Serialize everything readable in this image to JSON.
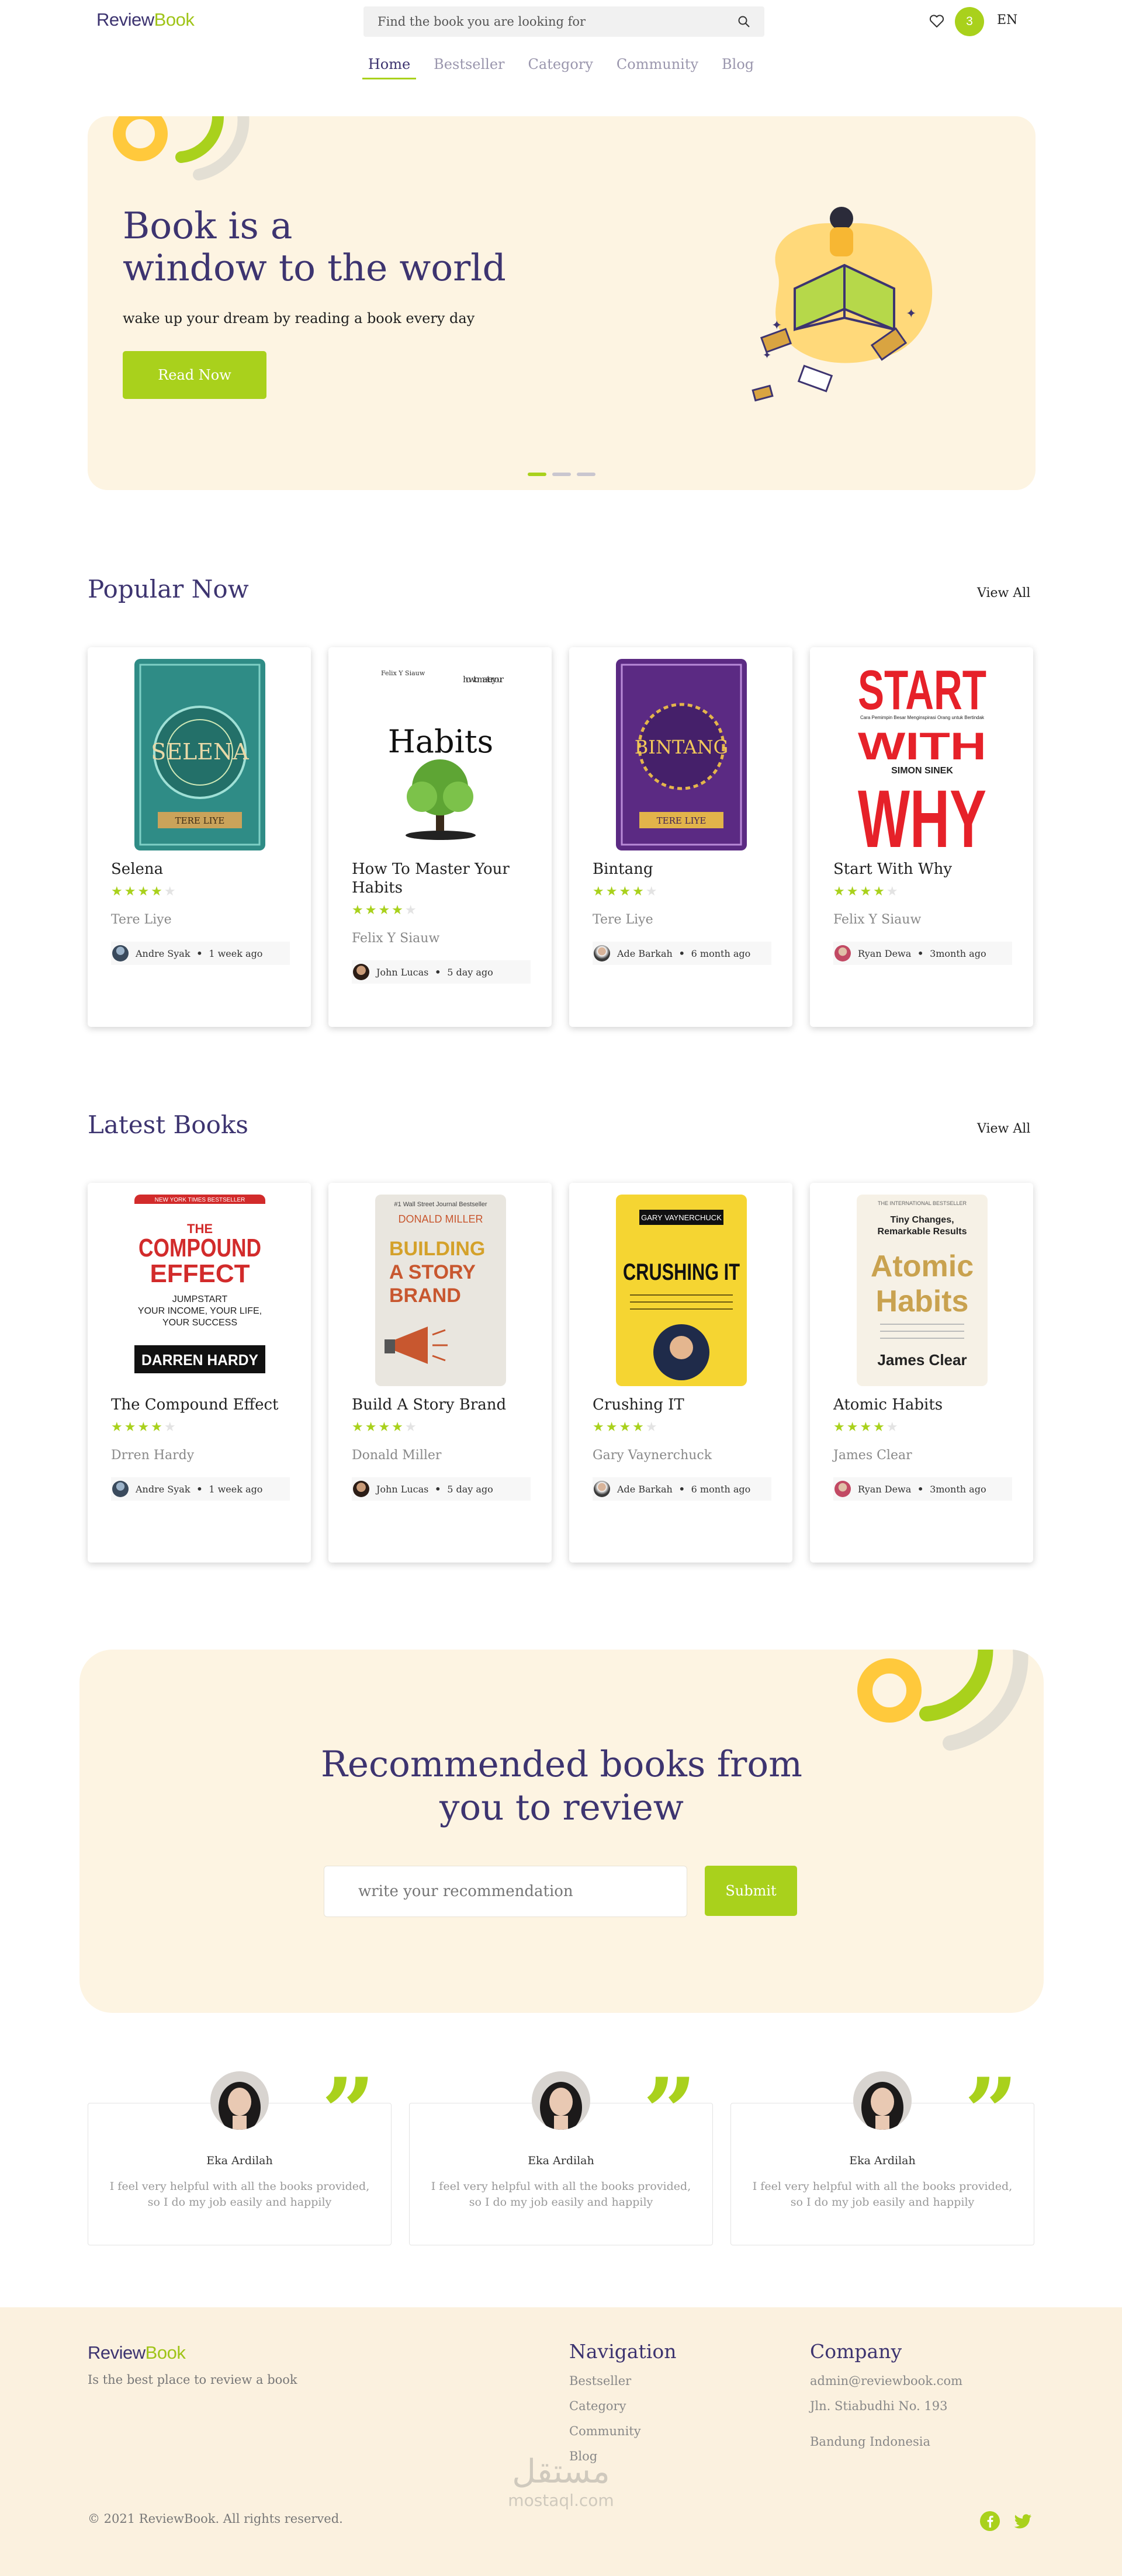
{
  "header": {
    "logo_part1": "Review",
    "logo_part2": "Book",
    "search_placeholder": "Find the book you are looking for",
    "cart_count": "3",
    "language": "EN"
  },
  "nav": [
    "Home",
    "Bestseller",
    "Category",
    "Community",
    "Blog"
  ],
  "hero": {
    "title_line1": "Book is a",
    "title_line2": "window to the world",
    "subtitle": "wake up your dream by reading a book every day",
    "button": "Read Now",
    "slides_total": 3,
    "active_slide": 1
  },
  "popular": {
    "title": "Popular Now",
    "view_all": "View All",
    "books": [
      {
        "title": "Selena",
        "rating": 4,
        "author": "Tere Liye",
        "reviewer": "Andre Syak",
        "time": "1 week ago"
      },
      {
        "title": "How To Master Your Habits",
        "rating": 4,
        "author": "Felix Y Siauw",
        "reviewer": "John Lucas",
        "time": "5 day ago"
      },
      {
        "title": "Bintang",
        "rating": 4,
        "author": "Tere Liye",
        "reviewer": "Ade Barkah",
        "time": "6 month ago"
      },
      {
        "title": "Start With Why",
        "rating": 4,
        "author": "Felix Y Siauw",
        "reviewer": "Ryan Dewa",
        "time": "3month ago"
      }
    ]
  },
  "latest": {
    "title": "Latest Books",
    "view_all": "View All",
    "books": [
      {
        "title": "The Compound Effect",
        "rating": 4,
        "author": "Drren Hardy",
        "reviewer": "Andre Syak",
        "time": "1 week ago"
      },
      {
        "title": "Build A Story Brand",
        "rating": 4,
        "author": "Donald Miller",
        "reviewer": "John Lucas",
        "time": "5 day ago"
      },
      {
        "title": "Crushing IT",
        "rating": 4,
        "author": "Gary Vaynerchuck",
        "reviewer": "Ade Barkah",
        "time": "6 month ago"
      },
      {
        "title": "Atomic Habits",
        "rating": 4,
        "author": "James Clear",
        "reviewer": "Ryan Dewa",
        "time": "3month ago"
      }
    ]
  },
  "covers": {
    "selena": {
      "title": "SELENA",
      "author": "TERE LIYE"
    },
    "habits": {
      "top_left": "Felix Y Siauw",
      "corner": "how to master your",
      "title": "Habits"
    },
    "bintang": {
      "title": "BINTANG",
      "author": "TERE LIYE"
    },
    "startwhy": {
      "line1": "START",
      "line2": "WITH",
      "line3": "WHY",
      "author": "SIMON SINEK",
      "tagline": "Cara Pemimpin Besar Menginspirasi Orang untuk Bertindak"
    },
    "compound": {
      "top": "NEW YORK TIMES BESTSELLER",
      "title1": "THE",
      "title2": "COMPOUND",
      "title3": "EFFECT",
      "sub1": "JUMPSTART",
      "sub2": "YOUR INCOME, YOUR LIFE,",
      "sub3": "YOUR SUCCESS",
      "author": "DARREN HARDY"
    },
    "storybrand": {
      "top": "#1 Wall Street Journal Bestseller",
      "author": "DONALD MILLER",
      "title1": "BUILDING",
      "title2": "A STORY",
      "title3": "BRAND"
    },
    "crushing": {
      "author": "GARY VAYNERCHUCK",
      "title": "CRUSHING IT"
    },
    "atomic": {
      "top": "THE INTERNATIONAL BESTSELLER",
      "tag1": "Tiny Changes,",
      "tag2": "Remarkable Results",
      "title1": "Atomic",
      "title2": "Habits",
      "author": "James Clear"
    }
  },
  "recommend": {
    "title_line1": "Recommended books from",
    "title_line2": "you to review",
    "placeholder": "write your recommendation",
    "button": "Submit"
  },
  "testimonials": [
    {
      "name": "Eka Ardilah",
      "line1": "I feel very helpful with all the books provided,",
      "line2": "so I do my job easily and happily"
    },
    {
      "name": "Eka Ardilah",
      "line1": "I feel very helpful with all the books provided,",
      "line2": "so I do my job easily and happily"
    },
    {
      "name": "Eka Ardilah",
      "line1": "I feel very helpful with all the books provided,",
      "line2": "so I do my job easily and happily"
    }
  ],
  "footer": {
    "logo_part1": "Review",
    "logo_part2": "Book",
    "tagline": "Is the best place to review a book",
    "nav_title": "Navigation",
    "nav_links": [
      "Bestseller",
      "Category",
      "Community",
      "Blog"
    ],
    "company_title": "Company",
    "email": "admin@reviewbook.com",
    "address1": "Jln. Stiabudhi No. 193",
    "address2": "Bandung Indonesia",
    "copyright": "© 2021 ReviewBook. All rights reserved.",
    "watermark_ar": "مستقل",
    "watermark_en": "mostaql.com"
  },
  "colors": {
    "primary": "#3d3470",
    "accent": "#a9d11c",
    "cream": "#fdf4e2",
    "yellow": "#ffc93c"
  },
  "icons": [
    "search-icon",
    "heart-icon",
    "quote-icon",
    "facebook-icon",
    "twitter-icon",
    "star-icon"
  ]
}
